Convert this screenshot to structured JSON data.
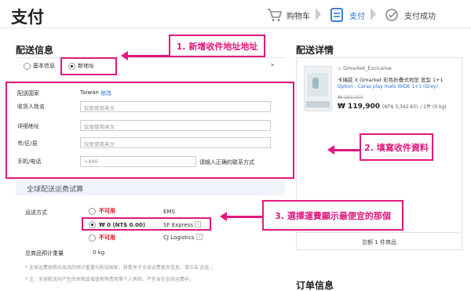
{
  "header": {
    "title": "支付",
    "steps": [
      {
        "label": "购物车"
      },
      {
        "label": "支付"
      },
      {
        "label": "支付成功"
      }
    ]
  },
  "delivery": {
    "section_title": "配送信息",
    "radio_basic": "基本信息",
    "radio_new": "新地址",
    "country_label": "配送国家",
    "country_value": "Taiwan",
    "country_edit": "修改",
    "name_label": "收货人姓名",
    "name_placeholder": "仅限使用英文",
    "address_label": "详细地址",
    "address_placeholder": "仅限使用英文",
    "city_label": "市/区/县",
    "city_placeholder": "仅限使用英文",
    "phone_label": "手机/电话",
    "phone_prefix": "+886",
    "phone_hint": "请输入正确的联系方式"
  },
  "shipping": {
    "title": "全球配送运费试算",
    "method_label": "运送方式",
    "options": [
      {
        "status": "不可用",
        "price": "",
        "carrier": "EMS"
      },
      {
        "status": "",
        "price": "₩ 0 (NT$ 0.00)",
        "carrier": "SF Express"
      },
      {
        "status": "不可用",
        "price": "",
        "carrier": "CJ Logistics"
      }
    ],
    "weight_label": "总商品预计重量",
    "weight_value": "0 kg",
    "note1": "* 全球运费按照总商品的预计重量与配送国家，慧看关于全球运费更多信息，请点击 此处 。",
    "note2": "* 注：全球配送时产生的关税或增值税等费用需个人承担，不包含在全球运费中。"
  },
  "details": {
    "title": "配送详情",
    "seller": "Gmarket_Exclusive",
    "product_name": "卡瑞兹 X Gmarket 彩色折叠式地垫 宽型 1+1",
    "option": "Option : Caraz play mats WIDE 1+1 (Grey)",
    "original_price": "₩ 189,000",
    "price": "₩ 119,900",
    "price_twd": "(NT$ 3,342.63)",
    "qty": "/ 1件 (0 kg)",
    "total": "总额 1 件商品",
    "order_title": "订单信息"
  },
  "callouts": {
    "c1": "1. 新增收件地址地址",
    "c2": "2. 填寫收件資料",
    "c3": "3. 選擇運費顯示最便宜的那個"
  },
  "colors": {
    "accent": "#e0197d",
    "link": "#1f6fd6",
    "price": "#e0001b"
  }
}
